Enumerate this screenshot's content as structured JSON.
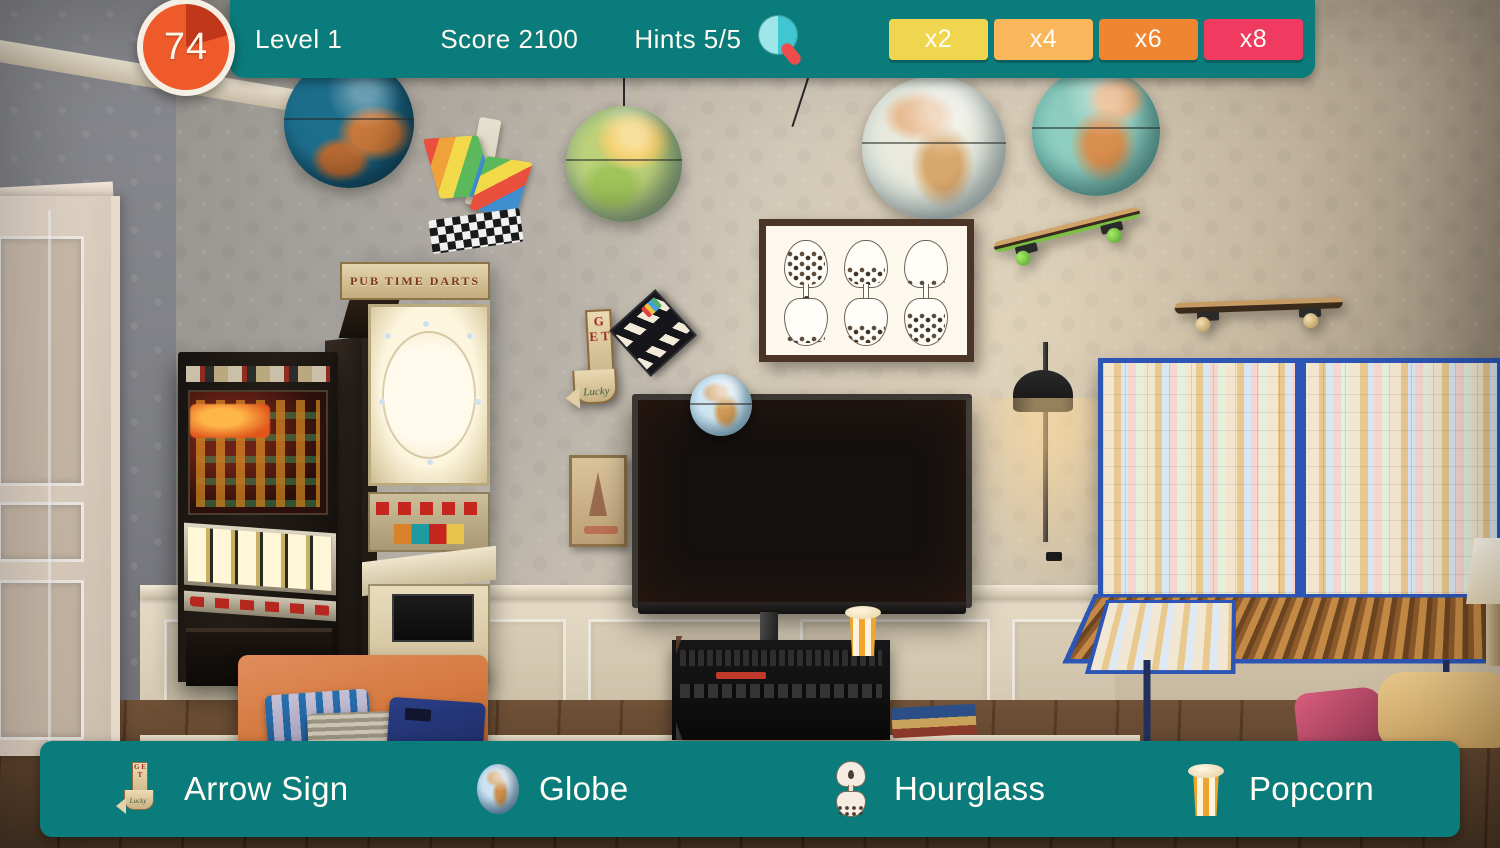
{
  "hud": {
    "timer_value": "74",
    "timer_colors": {
      "fill": "#ef5a2a",
      "wedge": "#c0371a",
      "ring": "#f5efe3"
    },
    "level_label": "Level 1",
    "score_label": "Score 2100",
    "hints_label": "Hints 5/5",
    "hint_icon": "magnifier-icon",
    "bar_color": "#0b7c7c",
    "multipliers": [
      {
        "label": "x2",
        "color": "#f0d64e"
      },
      {
        "label": "x4",
        "color": "#f8b košice"
      },
      {
        "label": "x6",
        "color": "#ef8531"
      },
      {
        "label": "x8",
        "color": "#f03a5f"
      }
    ]
  },
  "multiplier_colors": [
    "#f0d64e",
    "#fab65a",
    "#ef8531",
    "#f03a5f"
  ],
  "items": [
    {
      "label": "Arrow Sign",
      "icon": "arrow-sign-icon"
    },
    {
      "label": "Globe",
      "icon": "globe-icon"
    },
    {
      "label": "Hourglass",
      "icon": "hourglass-icon"
    },
    {
      "label": "Popcorn",
      "icon": "popcorn-icon"
    }
  ],
  "scene": {
    "description": "Hidden object game room scene",
    "darts_marquee": "PUB TIME DARTS",
    "darts_logo": "PUB TIME",
    "arrow_sign_letters": "G E T",
    "arrow_sign_word": "Lucky"
  }
}
